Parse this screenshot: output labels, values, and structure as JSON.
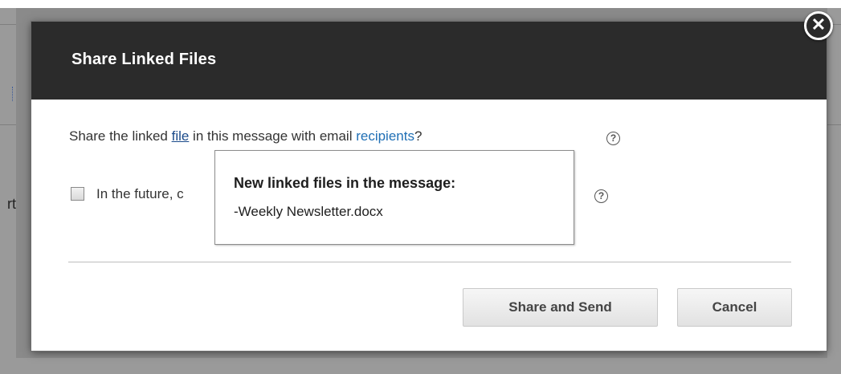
{
  "background": {
    "partial_text": "rt"
  },
  "dialog": {
    "title": "Share Linked Files",
    "close_glyph": "✕",
    "prompt": {
      "before": "Share the linked ",
      "file_link": "file",
      "middle": " in this message with email ",
      "recipients_link": "recipients",
      "after": "?"
    },
    "help_glyph": "?",
    "checkbox": {
      "label": "In the future, c",
      "checked": false
    },
    "tooltip": {
      "title": "New linked files in the message:",
      "file": "-Weekly Newsletter.docx"
    },
    "buttons": {
      "share_send": "Share and Send",
      "cancel": "Cancel"
    }
  },
  "colors": {
    "header_bg": "#2b2b2b",
    "link": "#1f6fb5",
    "overlay": "#8a8a8a"
  }
}
